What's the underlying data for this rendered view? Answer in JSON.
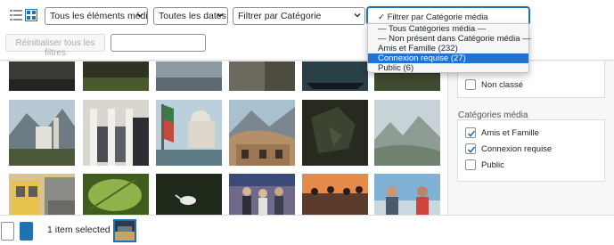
{
  "toolbar": {
    "media_type_select": "Tous les éléments média",
    "dates_select": "Toutes les dates",
    "category_select": "Filtrer par Catégorie",
    "reset_button": "Réinitialiser tous les filtres",
    "search_placeholder": ""
  },
  "dropdown": {
    "items": [
      {
        "label": "✓ Filtrer par Catégorie média"
      },
      {
        "label": "— Tous Catégories média —"
      },
      {
        "label": "— Non présent dans Catégorie média —"
      },
      {
        "label": "Amis et Famille  (232)"
      },
      {
        "label": "Connexion requise  (27)"
      },
      {
        "label": "Public  (6)"
      }
    ],
    "highlighted_index": 4
  },
  "sidebar": {
    "unclassified_label": "Non classé",
    "categories_heading": "Catégories média",
    "categories": [
      {
        "label": "Amis et Famille",
        "checked": true
      },
      {
        "label": "Connexion requise",
        "checked": true
      },
      {
        "label": "Public",
        "checked": false
      }
    ]
  },
  "bottom": {
    "selected_text": "1 item selected"
  },
  "colors": {
    "accent": "#2271b1",
    "highlight": "#2372d3"
  }
}
